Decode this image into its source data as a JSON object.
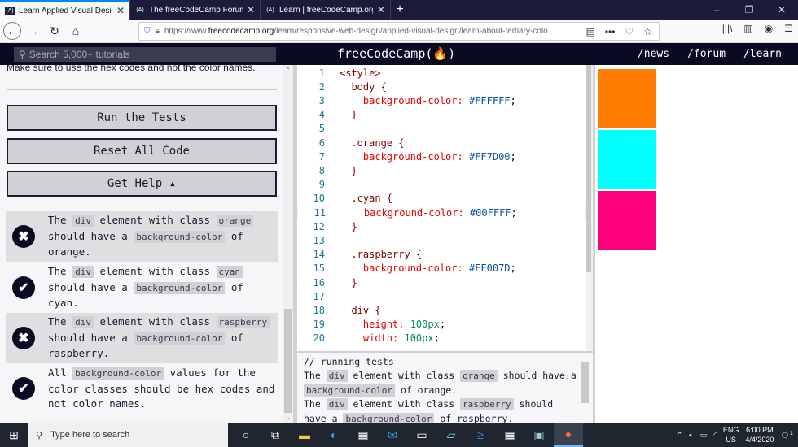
{
  "browser": {
    "tabs": [
      {
        "title": "Learn Applied Visual Design: Le",
        "active": true
      },
      {
        "title": "The freeCodeCamp Forum - Jo",
        "active": false
      },
      {
        "title": "Learn | freeCodeCamp.org",
        "active": false
      }
    ],
    "new_tab": "+",
    "window_controls": {
      "minimize": "–",
      "restore": "❐",
      "close": "✕"
    },
    "url_prefix": "https://www.",
    "url_domain": "freecodecamp.org",
    "url_path": "/learn/responsive-web-design/applied-visual-design/learn-about-tertiary-colo"
  },
  "fcc": {
    "search_placeholder": "Search 5,000+ tutorials",
    "logo": "freeCodeCamp(🔥)",
    "nav": [
      "/news",
      "/forum",
      "/learn"
    ]
  },
  "left": {
    "instruction": "Make sure to use the hex codes and not the color names.",
    "buttons": {
      "run": "Run the Tests",
      "reset": "Reset All Code",
      "help": "Get Help ▴"
    },
    "tests": [
      {
        "status": "fail",
        "parts": [
          "The ",
          {
            "code": "div"
          },
          " element with class ",
          {
            "code": "orange"
          },
          " should have a ",
          {
            "code": "background-color"
          },
          " of orange."
        ]
      },
      {
        "status": "pass",
        "parts": [
          "The ",
          {
            "code": "div"
          },
          " element with class ",
          {
            "code": "cyan"
          },
          " should have a ",
          {
            "code": "background-color"
          },
          " of cyan."
        ]
      },
      {
        "status": "fail",
        "parts": [
          "The ",
          {
            "code": "div"
          },
          " element with class ",
          {
            "code": "raspberry"
          },
          " should have a ",
          {
            "code": "background-color"
          },
          " of raspberry."
        ]
      },
      {
        "status": "pass",
        "parts": [
          "All ",
          {
            "code": "background-color"
          },
          " values for the color classes should be hex codes and not color names."
        ]
      }
    ]
  },
  "editor": {
    "lines": [
      [
        {
          "t": "<style>",
          "c": "sel"
        }
      ],
      [
        {
          "t": "  body {",
          "c": "sel"
        }
      ],
      [
        {
          "t": "    background-color: ",
          "c": "prop"
        },
        {
          "t": "#FFFFFF",
          "c": "hex"
        },
        {
          "t": ";",
          "c": ""
        }
      ],
      [
        {
          "t": "  }",
          "c": "sel"
        }
      ],
      [],
      [
        {
          "t": "  .orange {",
          "c": "sel"
        }
      ],
      [
        {
          "t": "    background-color: ",
          "c": "prop"
        },
        {
          "t": "#FF7D00",
          "c": "hex"
        },
        {
          "t": ";",
          "c": ""
        }
      ],
      [
        {
          "t": "  }",
          "c": "sel"
        }
      ],
      [],
      [
        {
          "t": "  .cyan {",
          "c": "sel"
        }
      ],
      [
        {
          "t": "    background-color: ",
          "c": "prop"
        },
        {
          "t": "#00FFFF",
          "c": "hex"
        },
        {
          "t": ";",
          "c": ""
        }
      ],
      [
        {
          "t": "  }",
          "c": "sel"
        }
      ],
      [],
      [
        {
          "t": "  .raspberry {",
          "c": "sel"
        }
      ],
      [
        {
          "t": "    background-color: ",
          "c": "prop"
        },
        {
          "t": "#FF007D",
          "c": "hex"
        },
        {
          "t": ";",
          "c": ""
        }
      ],
      [
        {
          "t": "  }",
          "c": "sel"
        }
      ],
      [],
      [
        {
          "t": "  div {",
          "c": "sel"
        }
      ],
      [
        {
          "t": "    height: ",
          "c": "prop"
        },
        {
          "t": "100px",
          "c": "num2"
        },
        {
          "t": ";",
          "c": ""
        }
      ],
      [
        {
          "t": "    width: ",
          "c": "prop"
        },
        {
          "t": "100px",
          "c": "num2"
        },
        {
          "t": ";",
          "c": ""
        }
      ]
    ],
    "current_line": 11
  },
  "console": {
    "header": "// running tests",
    "messages": [
      [
        "The ",
        {
          "code": "div"
        },
        " element with class ",
        {
          "code": "orange"
        },
        " should have a ",
        {
          "code": "background-color"
        },
        " of orange."
      ],
      [
        "The ",
        {
          "code": "div"
        },
        " element with class ",
        {
          "code": "raspberry"
        },
        " should have a ",
        {
          "code": "background-color"
        },
        " of raspberry."
      ]
    ]
  },
  "preview": {
    "boxes": [
      {
        "name": "orange",
        "color": "#FF7D00"
      },
      {
        "name": "cyan",
        "color": "#00FFFF"
      },
      {
        "name": "raspberry",
        "color": "#FF007D"
      }
    ]
  },
  "taskbar": {
    "search_placeholder": "Type here to search",
    "lang": "ENG",
    "region": "US",
    "time": "6:00 PM",
    "date": "4/4/2020",
    "notifications": "1"
  }
}
